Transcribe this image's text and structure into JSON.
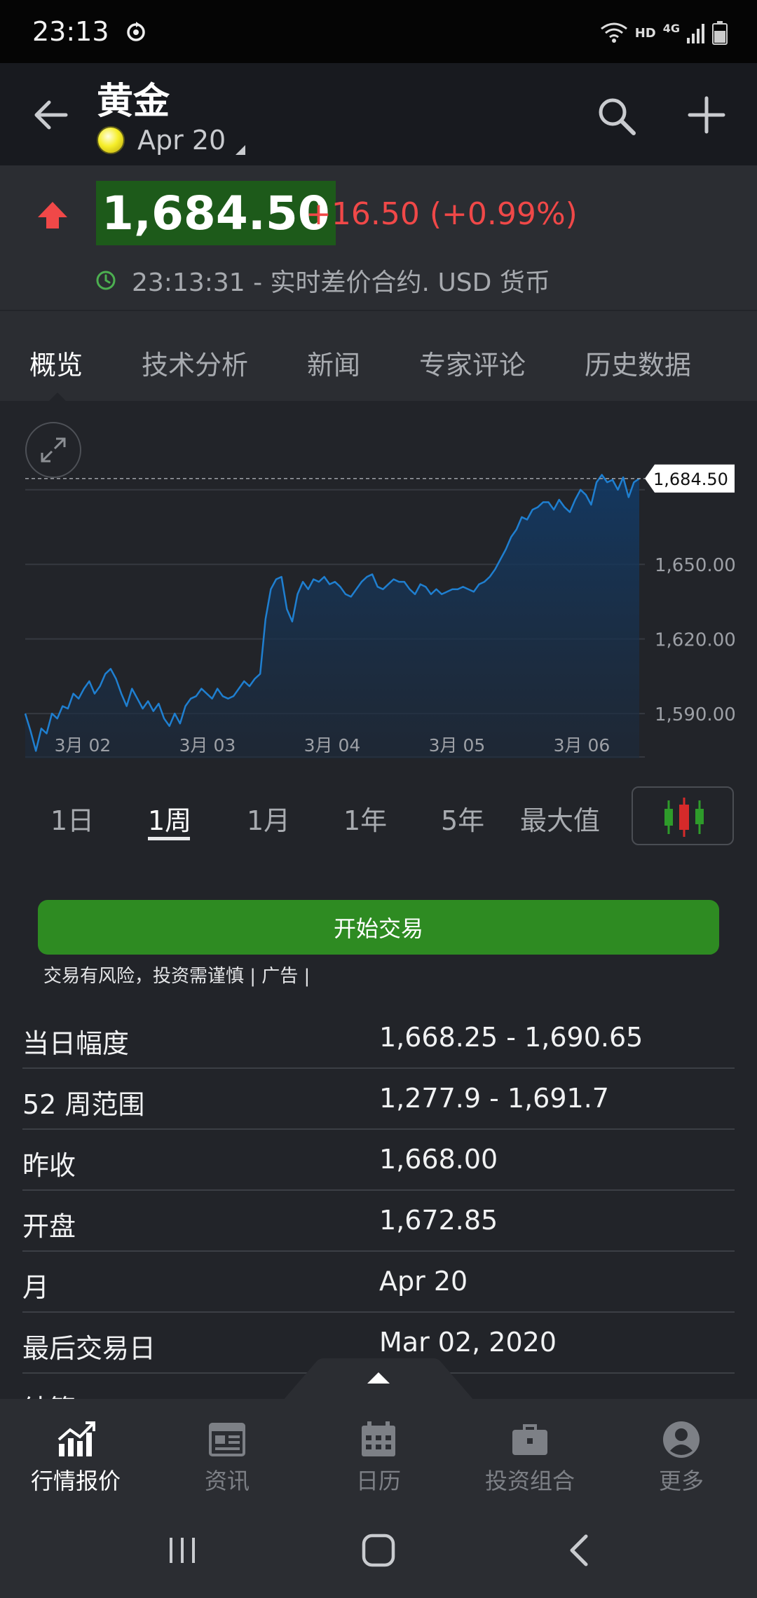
{
  "status_bar": {
    "time": "23:13",
    "hd": "HD",
    "network": "4G"
  },
  "header": {
    "title": "黄金",
    "contract": "Apr 20"
  },
  "quote": {
    "price": "1,684.50",
    "change": "+16.50 (+0.99%)",
    "meta": "23:13:31 - 实时差价合约. USD 货币",
    "direction": "up",
    "up_color": "#f04848",
    "price_bg": "#1d5a1a"
  },
  "tabs": [
    {
      "label": "概览",
      "active": true
    },
    {
      "label": "技术分析",
      "active": false
    },
    {
      "label": "新闻",
      "active": false
    },
    {
      "label": "专家评论",
      "active": false
    },
    {
      "label": "历史数据",
      "active": false
    }
  ],
  "chart_data": {
    "type": "area",
    "line_color": "#1f7fd0",
    "y_ticks": [
      "1,590.00",
      "1,620.00",
      "1,650.00"
    ],
    "y_tick_values": [
      1590,
      1620,
      1650
    ],
    "ylim": [
      1572,
      1696
    ],
    "x_ticks": [
      "3月 02",
      "3月 03",
      "3月 04",
      "3月 05",
      "3月 06"
    ],
    "current_label": "1,684.50",
    "current_value": 1684.5,
    "series": [
      {
        "values": [
          1590,
          1583,
          1575,
          1584,
          1582,
          1590,
          1588,
          1593,
          1592,
          1598,
          1596,
          1600,
          1603,
          1598,
          1601,
          1606,
          1608,
          1604,
          1598,
          1593,
          1600,
          1596,
          1592,
          1595,
          1591,
          1594,
          1588,
          1585,
          1590,
          1586,
          1593,
          1596,
          1597,
          1600,
          1598,
          1596,
          1600,
          1597,
          1596,
          1597,
          1600,
          1603,
          1601,
          1604,
          1606,
          1628,
          1640,
          1644,
          1645,
          1632,
          1627,
          1638,
          1643,
          1640,
          1644,
          1643,
          1645,
          1642,
          1643,
          1641,
          1638,
          1637,
          1640,
          1643,
          1645,
          1646,
          1641,
          1640,
          1642,
          1644,
          1643,
          1643,
          1640,
          1638,
          1642,
          1641,
          1638,
          1640,
          1638,
          1639,
          1640,
          1640,
          1641,
          1640,
          1639,
          1642,
          1643,
          1645,
          1648,
          1652,
          1656,
          1661,
          1664,
          1669,
          1668,
          1672,
          1673,
          1675,
          1675,
          1672,
          1676,
          1673,
          1671,
          1676,
          1680,
          1678,
          1674,
          1683,
          1686,
          1683,
          1684,
          1680,
          1685,
          1677,
          1683,
          1684.5
        ]
      }
    ]
  },
  "periods": [
    {
      "label": "1日",
      "active": false
    },
    {
      "label": "1周",
      "active": true
    },
    {
      "label": "1月",
      "active": false
    },
    {
      "label": "1年",
      "active": false
    },
    {
      "label": "5年",
      "active": false
    },
    {
      "label": "最大值",
      "active": false
    }
  ],
  "trade": {
    "button_label": "开始交易",
    "disclaimer": "交易有风险，投资需谨慎 | 广告 |",
    "color": "#2e8b22"
  },
  "stats": [
    {
      "label": "当日幅度",
      "value": "1,668.25 - 1,690.65"
    },
    {
      "label": "52 周范围",
      "value": "1,277.9 - 1,691.7"
    },
    {
      "label": "昨收",
      "value": "1,668.00"
    },
    {
      "label": "开盘",
      "value": "1,672.85"
    },
    {
      "label": "月",
      "value": "Apr 20"
    },
    {
      "label": "最后交易日",
      "value": "Mar 02, 2020"
    },
    {
      "label": "结算",
      "value": ""
    }
  ],
  "bottom_nav": [
    {
      "label": "行情报价",
      "icon": "chart-icon",
      "active": true
    },
    {
      "label": "资讯",
      "icon": "news-icon",
      "active": false
    },
    {
      "label": "日历",
      "icon": "calendar-icon",
      "active": false
    },
    {
      "label": "投资组合",
      "icon": "briefcase-icon",
      "active": false
    },
    {
      "label": "更多",
      "icon": "user-icon",
      "active": false
    }
  ]
}
